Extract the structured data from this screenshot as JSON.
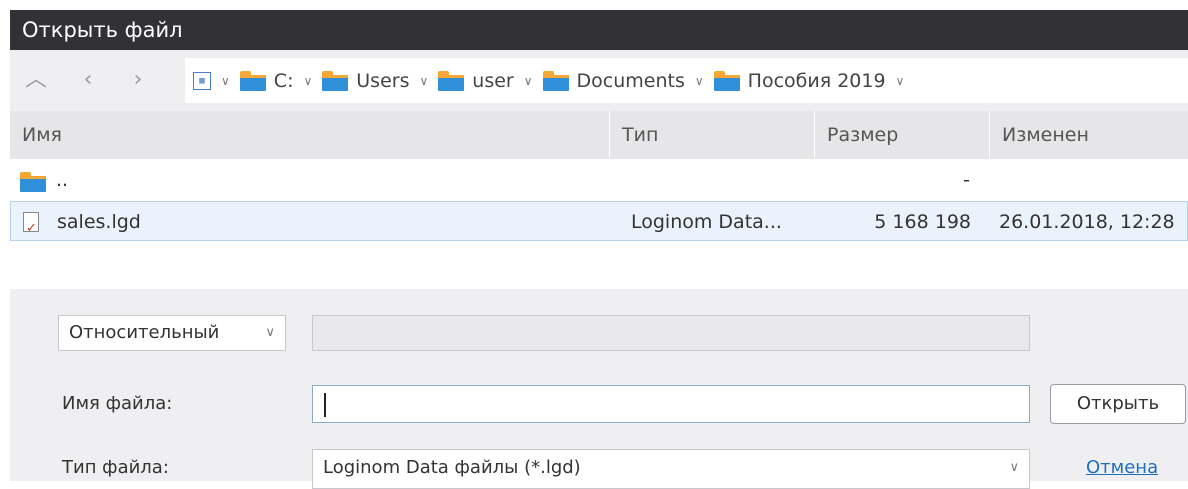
{
  "window": {
    "title": "Открыть файл"
  },
  "nav": {
    "up_icon": "chevron-up-icon",
    "back_icon": "chevron-left-icon",
    "forward_icon": "chevron-right-icon"
  },
  "breadcrumb": {
    "root_icon": "calendar-icon",
    "items": [
      {
        "label": "C:"
      },
      {
        "label": "Users"
      },
      {
        "label": "user"
      },
      {
        "label": "Documents"
      },
      {
        "label": "Пособия 2019"
      }
    ]
  },
  "table": {
    "columns": [
      "Имя",
      "Тип",
      "Размер",
      "Изменен"
    ],
    "rows": [
      {
        "name": "..",
        "type": "",
        "size": "-",
        "modified": ""
      },
      {
        "name": "sales.lgd",
        "type": "Loginom Data...",
        "size": "5 168 198",
        "modified": "26.01.2018, 12:28"
      }
    ]
  },
  "form": {
    "path_mode": "Относительный",
    "path_value": "",
    "filename_label": "Имя файла:",
    "filename_value": "",
    "filetype_label": "Тип файла:",
    "filetype_value": "Loginom Data файлы (*.lgd)",
    "open_label": "Открыть",
    "cancel_label": "Отмена"
  }
}
